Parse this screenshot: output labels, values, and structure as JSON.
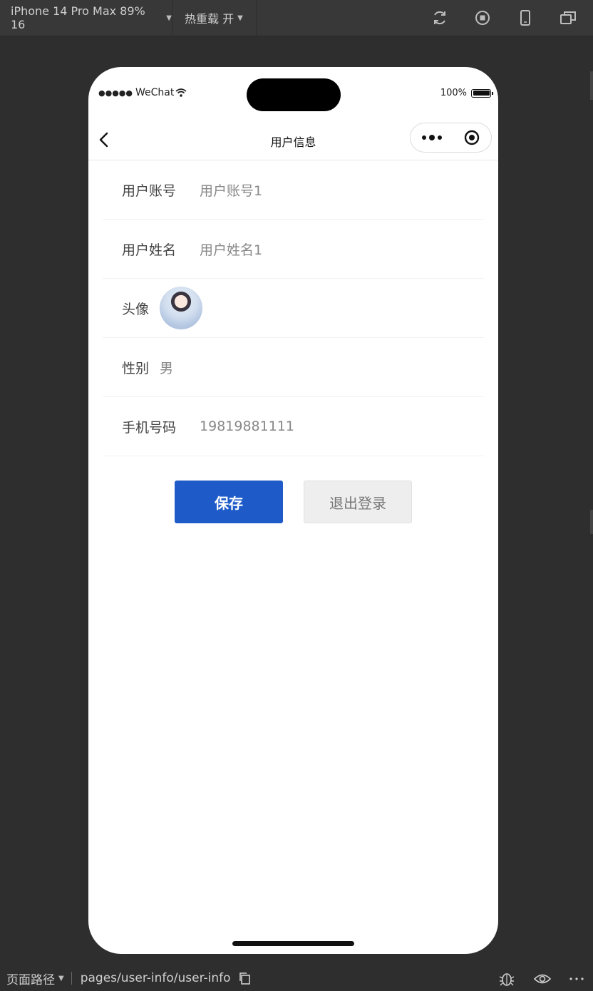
{
  "devtools": {
    "device_label": "iPhone 14 Pro Max 89% 16",
    "hot_reload_label": "热重载 开"
  },
  "phone": {
    "status_bar": {
      "carrier": "WeChat",
      "battery_percent": "100%"
    },
    "navbar": {
      "title": "用户信息"
    },
    "form": {
      "account": {
        "label": "用户账号",
        "value": "用户账号1"
      },
      "name": {
        "label": "用户姓名",
        "value": "用户姓名1"
      },
      "avatar": {
        "label": "头像"
      },
      "gender": {
        "label": "性别",
        "value": "男"
      },
      "phone": {
        "label": "手机号码",
        "value": "19819881111"
      }
    },
    "buttons": {
      "save": "保存",
      "logout": "退出登录"
    }
  },
  "bottom_bar": {
    "path_label": "页面路径",
    "path_value": "pages/user-info/user-info"
  },
  "colors": {
    "primary": "#1e5bc8",
    "devtools_bg": "#2e2e2e"
  }
}
